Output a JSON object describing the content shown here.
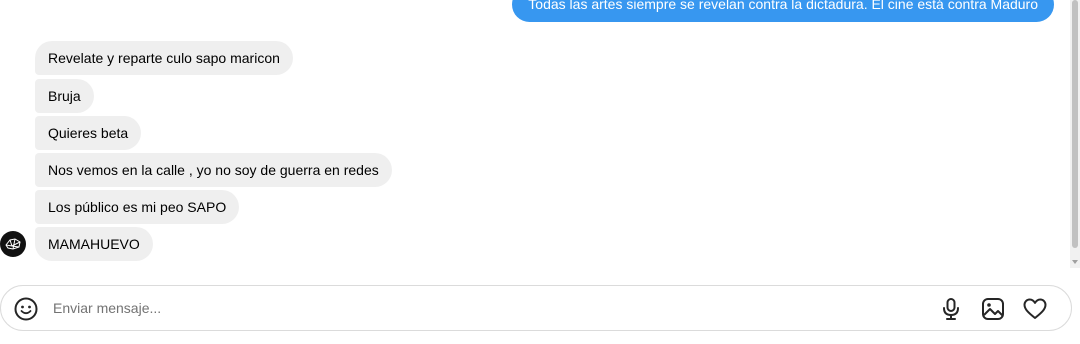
{
  "conversation": {
    "outgoing": [
      {
        "text": "Todas las artes siempre se revelan contra la dictadura. El cine está contra Maduro"
      }
    ],
    "incoming": [
      {
        "text": "Revelate y reparte culo sapo maricon"
      },
      {
        "text": "Bruja"
      },
      {
        "text": "Quieres beta"
      },
      {
        "text": "Nos vemos en la calle , yo no soy de guerra en redes"
      },
      {
        "text": "Los público es mi peo SAPO"
      },
      {
        "text": "MAMAHUEVO"
      }
    ]
  },
  "composer": {
    "placeholder": "Enviar mensaje...",
    "value": "",
    "icons": [
      "emoji-icon",
      "microphone-icon",
      "image-icon",
      "heart-icon"
    ]
  },
  "colors": {
    "outgoing_bubble": "#3797f0",
    "incoming_bubble": "#efefef",
    "composer_border": "#dbdbdb"
  }
}
